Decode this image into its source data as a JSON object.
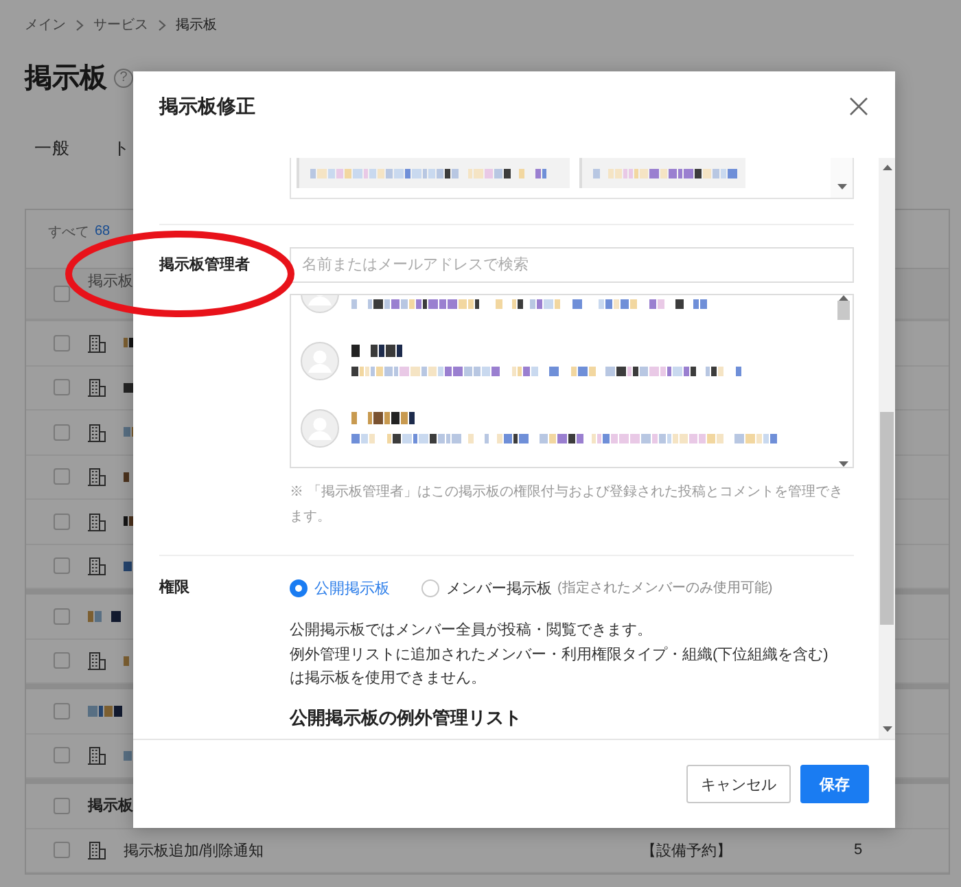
{
  "breadcrumb": [
    {
      "label": "メイン"
    },
    {
      "label": "サービス"
    },
    {
      "label": "掲示板"
    }
  ],
  "page_title": "掲示板",
  "help_icon": "?",
  "tabs": [
    {
      "label": "一般"
    },
    {
      "label": "ト"
    }
  ],
  "board_table": {
    "filter_label": "すべて",
    "total_count": "68",
    "header_checked": false,
    "columns": [
      {
        "label": "掲示板"
      }
    ],
    "rows": [
      {
        "kind": "board",
        "checked": false,
        "redacted": true
      },
      {
        "kind": "board",
        "checked": false,
        "redacted": true
      },
      {
        "kind": "board",
        "checked": false,
        "redacted": true
      },
      {
        "kind": "board",
        "checked": false,
        "redacted": true
      },
      {
        "kind": "board",
        "checked": false,
        "redacted": true
      },
      {
        "kind": "board",
        "checked": false,
        "redacted": true
      },
      {
        "kind": "group",
        "checked": false,
        "redacted": true
      },
      {
        "kind": "board",
        "checked": false,
        "redacted": true
      },
      {
        "kind": "group",
        "checked": false,
        "redacted": true
      },
      {
        "kind": "board",
        "checked": false,
        "redacted": true
      },
      {
        "kind": "group",
        "checked": false,
        "name": "掲示板"
      },
      {
        "kind": "board",
        "checked": false,
        "name": "掲示板追加/削除通知",
        "column_3": "【設備予約】",
        "column_4": "5"
      }
    ]
  },
  "modal": {
    "title": "掲示板修正",
    "selected_items": [
      {
        "redacted": true
      },
      {
        "redacted": true
      }
    ],
    "admin": {
      "label": "掲示板管理者",
      "search_placeholder": "名前またはメールアドレスで検索",
      "members": [
        {
          "redacted": true
        },
        {
          "redacted": true
        },
        {
          "redacted": true
        }
      ],
      "note": "※ 「掲示板管理者」はこの掲示板の権限付与および登録された投稿とコメントを管理できます。"
    },
    "permission": {
      "label": "権限",
      "options": [
        {
          "label": "公開掲示板",
          "selected": true
        },
        {
          "label": "メンバー掲示板",
          "hint": "(指定されたメンバーのみ使用可能)",
          "selected": false
        }
      ],
      "description": [
        "公開掲示板ではメンバー全員が投稿・閲覧できます。",
        "例外管理リストに追加されたメンバー・利用権限タイプ・組織(下位組織を含む)",
        "は掲示板を使用できません。"
      ],
      "exception_list_title": "公開掲示板の例外管理リスト"
    },
    "buttons": [
      {
        "label": "キャンセル",
        "kind": "secondary"
      },
      {
        "label": "保存",
        "kind": "primary"
      }
    ]
  },
  "annotation": {
    "kind": "ellipse"
  }
}
